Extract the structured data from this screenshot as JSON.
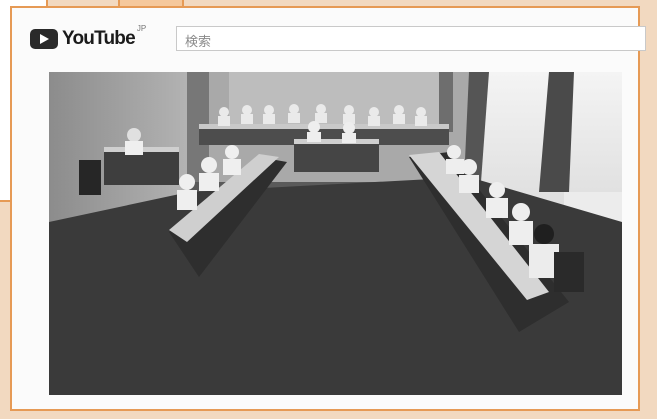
{
  "youtube": {
    "logo_text": "YouTube",
    "region": "JP",
    "search_placeholder": "検索"
  },
  "video": {
    "icon": "council-meeting-photo"
  },
  "colors": {
    "frame_border": "#e69a55",
    "background": "#f2d9c0"
  }
}
